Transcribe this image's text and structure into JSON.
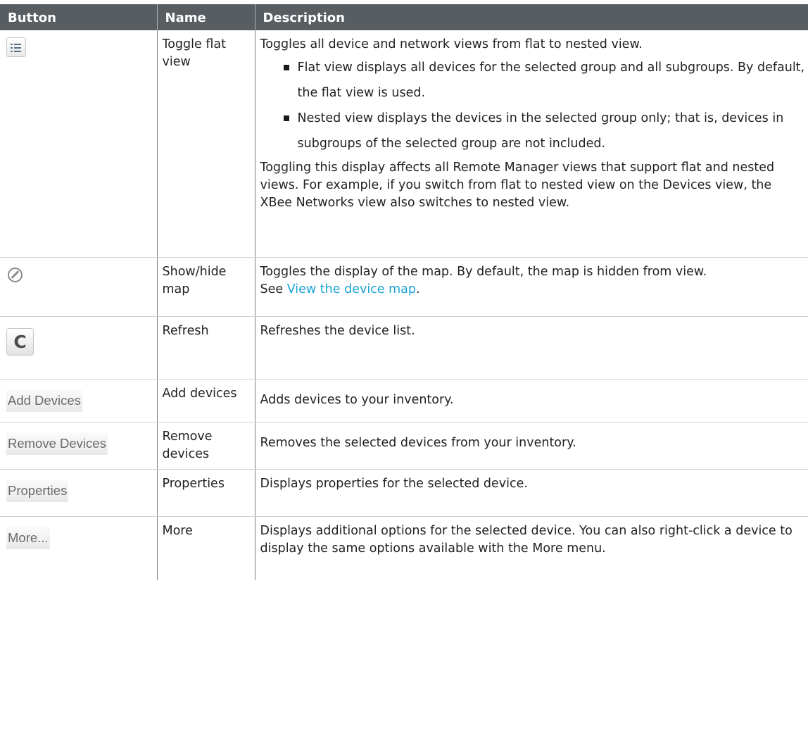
{
  "table": {
    "headers": [
      "Button",
      "Name",
      "Description"
    ],
    "rows": [
      {
        "icon": "list-view-icon",
        "name": "Toggle flat view",
        "intro": "Toggles all device and network views from flat to nested view.",
        "bullets": [
          "Flat view displays all devices for the selected group and all subgroups. By default, the flat view is used.",
          "Nested view displays the devices in the selected group only; that is, devices in subgroups of the selected group are not included."
        ],
        "outro": "Toggling this display affects all Remote Manager views that support flat and nested views. For example, if you switch from flat to nested view on the Devices view, the XBee Networks view also switches to nested view."
      },
      {
        "icon": "compass-icon",
        "name": "Show/hide map",
        "intro": "Toggles the display of the map. By default, the map is hidden from view.",
        "see_prefix": "See ",
        "link": "View the device map",
        "see_suffix": "."
      },
      {
        "icon": "refresh-icon",
        "icon_glyph": "C",
        "name": "Refresh",
        "desc": "Refreshes the device list."
      },
      {
        "button_label": "Add Devices",
        "name": "Add devices",
        "desc": "Adds devices to your inventory."
      },
      {
        "button_label": "Remove Devices",
        "name": "Remove devices",
        "desc": "Removes the selected devices from your inventory."
      },
      {
        "button_label": "Properties",
        "name": "Properties",
        "desc": "Displays properties for the selected device."
      },
      {
        "button_label": "More...",
        "name": "More",
        "desc": "Displays additional options for the selected device. You can also right-click a device to display the same options available with the More menu."
      }
    ]
  }
}
